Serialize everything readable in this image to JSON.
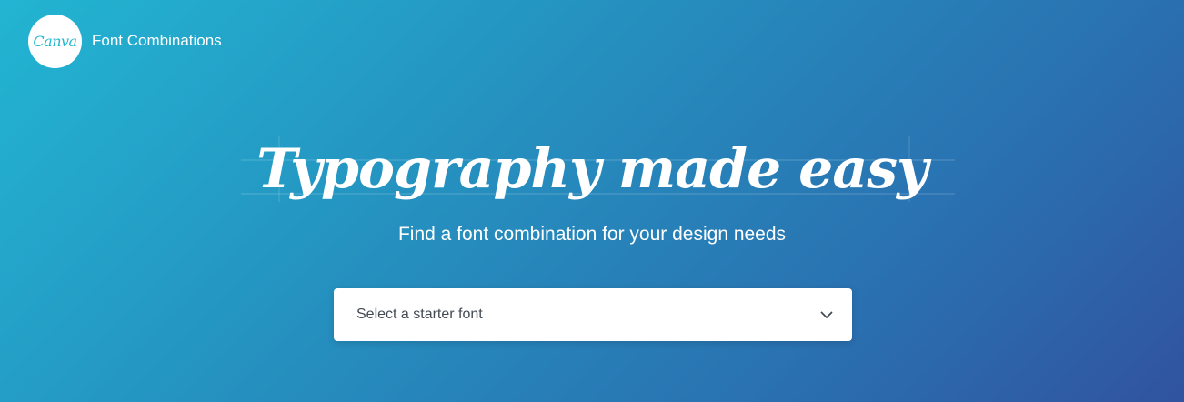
{
  "header": {
    "logo_text": "Canva",
    "title": "Font Combinations"
  },
  "hero": {
    "headline": "Typography made easy",
    "subheadline": "Find a font combination for your design needs"
  },
  "font_select": {
    "placeholder": "Select a starter font"
  },
  "icons": {
    "dropdown": "chevron-down-icon"
  },
  "colors": {
    "gradient_start": "#22b5d2",
    "gradient_end": "#3153a0",
    "logo_accent": "#23b8cf"
  }
}
